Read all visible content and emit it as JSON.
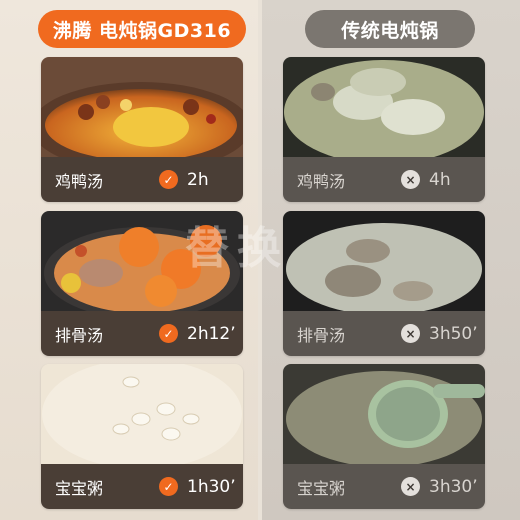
{
  "header": {
    "left_title": "沸腾 电炖锅GD316",
    "right_title": "传统电炖锅"
  },
  "left_cards": [
    {
      "name": "鸡鸭汤",
      "time": "2h",
      "mark": "check"
    },
    {
      "name": "排骨汤",
      "time": "2h12’",
      "mark": "check"
    },
    {
      "name": "宝宝粥",
      "time": "1h30’",
      "mark": "check"
    }
  ],
  "right_cards": [
    {
      "name": "鸡鸭汤",
      "time": "4h",
      "mark": "cross"
    },
    {
      "name": "排骨汤",
      "time": "3h50’",
      "mark": "cross"
    },
    {
      "name": "宝宝粥",
      "time": "3h30’",
      "mark": "cross"
    }
  ],
  "icons": {
    "check": "✓",
    "cross": "×"
  },
  "watermark": "替换",
  "colors": {
    "accent": "#f06a1f",
    "neutral_pill": "#7b7670",
    "left_bar": "#4a3e36",
    "right_bar": "#5a5550"
  }
}
